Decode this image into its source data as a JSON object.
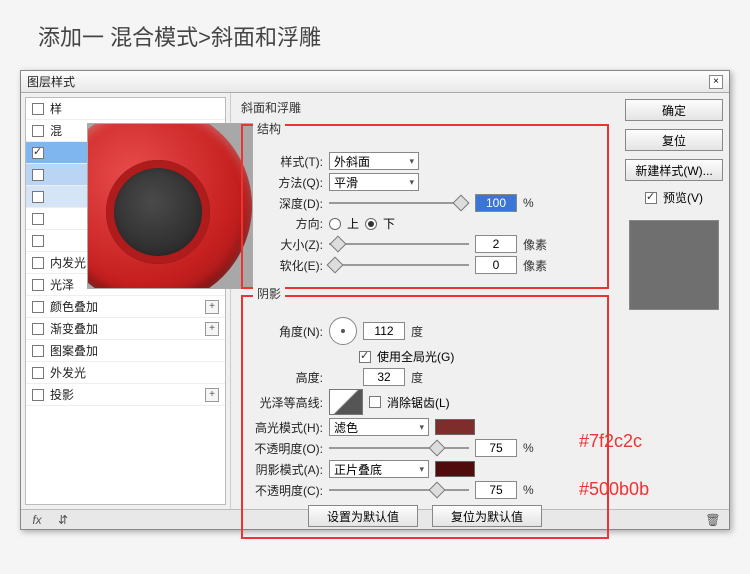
{
  "page_heading": "添加一 混合模式>斜面和浮雕",
  "dialog": {
    "title": "图层样式",
    "close": "×"
  },
  "sidebar": {
    "items": [
      {
        "label": "样",
        "checked": false,
        "hasPlus": false
      },
      {
        "label": "混",
        "checked": false,
        "hasPlus": false
      },
      {
        "label": "",
        "checked": true,
        "hasPlus": true,
        "selLevel": 1
      },
      {
        "label": "",
        "checked": false,
        "hasPlus": false,
        "selLevel": 2
      },
      {
        "label": "",
        "checked": false,
        "hasPlus": false,
        "selLevel": 3
      },
      {
        "label": "",
        "checked": false,
        "hasPlus": true
      },
      {
        "label": "",
        "checked": false,
        "hasPlus": true
      },
      {
        "label": "内发光",
        "checked": false,
        "hasPlus": false
      },
      {
        "label": "光泽",
        "checked": false,
        "hasPlus": false
      },
      {
        "label": "颜色叠加",
        "checked": false,
        "hasPlus": true
      },
      {
        "label": "渐变叠加",
        "checked": false,
        "hasPlus": true
      },
      {
        "label": "图案叠加",
        "checked": false,
        "hasPlus": false
      },
      {
        "label": "外发光",
        "checked": false,
        "hasPlus": false
      },
      {
        "label": "投影",
        "checked": false,
        "hasPlus": true
      }
    ]
  },
  "panel_title": "斜面和浮雕",
  "structure": {
    "legend": "结构",
    "style_label": "样式(T):",
    "style_value": "外斜面",
    "method_label": "方法(Q):",
    "method_value": "平滑",
    "depth_label": "深度(D):",
    "depth_value": "100",
    "depth_unit": "%",
    "direction_label": "方向:",
    "dir_up": "上",
    "dir_down": "下",
    "size_label": "大小(Z):",
    "size_value": "2",
    "size_unit": "像素",
    "soften_label": "软化(E):",
    "soften_value": "0",
    "soften_unit": "像素"
  },
  "shading": {
    "legend": "阴影",
    "angle_label": "角度(N):",
    "angle_value": "112",
    "angle_unit": "度",
    "global_label": "使用全局光(G)",
    "altitude_label": "高度:",
    "altitude_value": "32",
    "altitude_unit": "度",
    "gloss_label": "光泽等高线:",
    "anti_label": "消除锯齿(L)",
    "hmode_label": "高光模式(H):",
    "hmode_value": "滤色",
    "hcolor": "#7f2c2c",
    "hopacity_label": "不透明度(O):",
    "hopacity_value": "75",
    "hopacity_unit": "%",
    "smode_label": "阴影模式(A):",
    "smode_value": "正片叠底",
    "scolor": "#500b0b",
    "sopacity_label": "不透明度(C):",
    "sopacity_value": "75",
    "sopacity_unit": "%"
  },
  "buttons": {
    "ok": "确定",
    "cancel": "复位",
    "newstyle": "新建样式(W)...",
    "preview_label": "预览(V)",
    "default_set": "设置为默认值",
    "default_reset": "复位为默认值"
  },
  "annotations": {
    "c1": "#7f2c2c",
    "c2": "#500b0b"
  },
  "footer": {
    "fx": "fx"
  }
}
